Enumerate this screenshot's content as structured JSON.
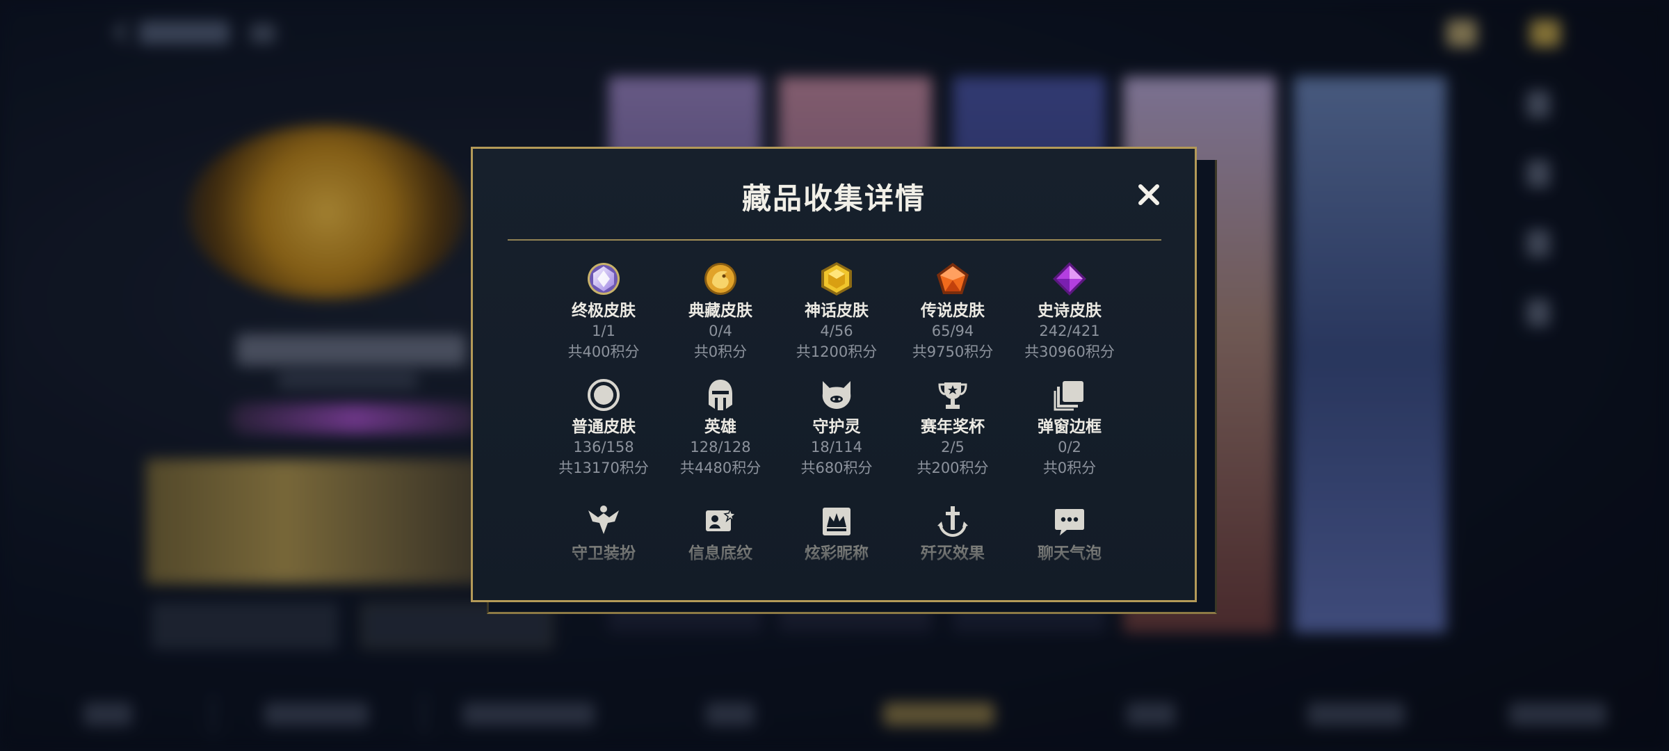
{
  "background": {
    "accent_gold": "#b49a58",
    "accent_purple": "#a24fc4"
  },
  "modal": {
    "title": "藏品收集详情",
    "close_icon": "close-icon",
    "items": [
      {
        "label": "终极皮肤",
        "count": "1/1",
        "points": "共400积分",
        "icon": "ultimate-skin-icon"
      },
      {
        "label": "典藏皮肤",
        "count": "0/4",
        "points": "共0积分",
        "icon": "collection-skin-icon"
      },
      {
        "label": "神话皮肤",
        "count": "4/56",
        "points": "共1200积分",
        "icon": "mythic-skin-icon"
      },
      {
        "label": "传说皮肤",
        "count": "65/94",
        "points": "共9750积分",
        "icon": "legendary-skin-icon"
      },
      {
        "label": "史诗皮肤",
        "count": "242/421",
        "points": "共30960积分",
        "icon": "epic-skin-icon"
      },
      {
        "label": "普通皮肤",
        "count": "136/158",
        "points": "共13170积分",
        "icon": "normal-skin-icon"
      },
      {
        "label": "英雄",
        "count": "128/128",
        "points": "共4480积分",
        "icon": "hero-helmet-icon"
      },
      {
        "label": "守护灵",
        "count": "18/114",
        "points": "共680积分",
        "icon": "guardian-spirit-icon"
      },
      {
        "label": "赛年奖杯",
        "count": "2/5",
        "points": "共200积分",
        "icon": "trophy-icon"
      },
      {
        "label": "弹窗边框",
        "count": "0/2",
        "points": "共0积分",
        "icon": "popup-frame-icon"
      },
      {
        "label": "守卫装扮",
        "icon": "guard-outfit-icon"
      },
      {
        "label": "信息底纹",
        "icon": "info-background-icon"
      },
      {
        "label": "炫彩昵称",
        "icon": "colorful-nickname-icon"
      },
      {
        "label": "歼灭效果",
        "icon": "kill-effect-icon"
      },
      {
        "label": "聊天气泡",
        "icon": "chat-bubble-icon"
      }
    ]
  }
}
